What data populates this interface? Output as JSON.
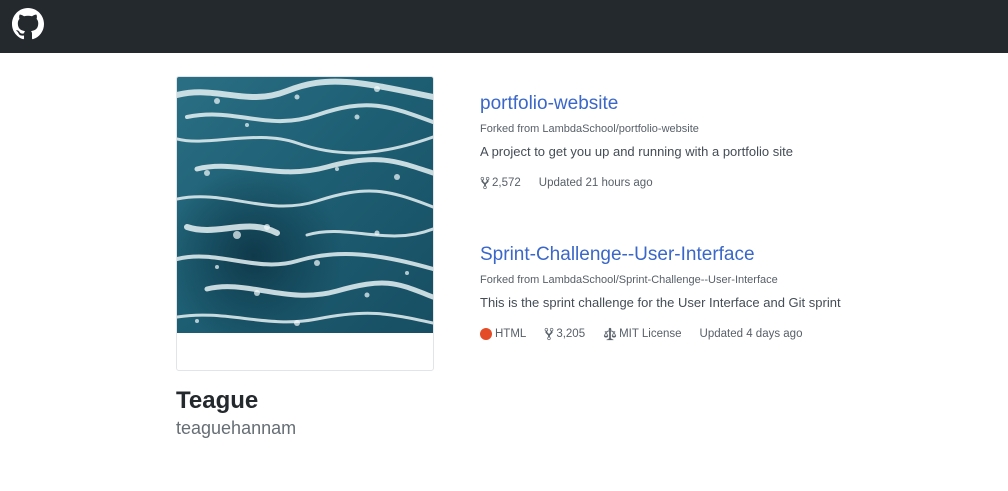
{
  "header": {
    "logo_icon": "github-mark-icon"
  },
  "profile": {
    "name": "Teague",
    "username": "teaguehannam"
  },
  "repos": [
    {
      "name": "portfolio-website",
      "forked_from": "Forked from LambdaSchool/portfolio-website",
      "description": "A project to get you up and running with a portfolio site",
      "forks": "2,572",
      "updated": "Updated 21 hours ago"
    },
    {
      "name": "Sprint-Challenge--User-Interface",
      "forked_from": "Forked from LambdaSchool/Sprint-Challenge--User-Interface",
      "description": "This is the sprint challenge for the User Interface and Git sprint",
      "language": "HTML",
      "language_color": "#e34c26",
      "forks": "3,205",
      "license": "MIT License",
      "updated": "Updated 4 days ago"
    }
  ],
  "colors": {
    "topbar": "#24292e",
    "link": "#3a67c8",
    "html_language": "#e34c26"
  }
}
